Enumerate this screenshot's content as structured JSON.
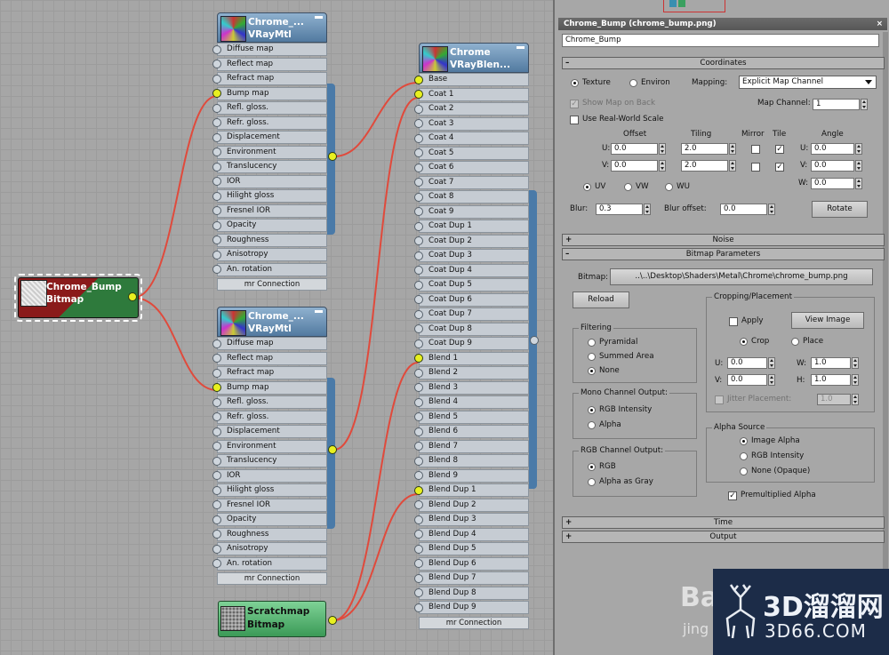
{
  "graph": {
    "source_chrome": {
      "title": "Chrome_Bump",
      "subtitle": "Bitmap"
    },
    "source_scratch": {
      "title": "Scratchmap",
      "subtitle": "Bitmap"
    },
    "vray_top": {
      "title": "Chrome_...",
      "subtitle": "VRayMtl",
      "footer": "mr Connection"
    },
    "vray_bottom": {
      "title": "Chrome_...",
      "subtitle": "VRayMtl",
      "footer": "mr Connection"
    },
    "vray_slots": [
      "Diffuse map",
      "Reflect map",
      "Refract map",
      "Bump map",
      "Refl. gloss.",
      "Refr. gloss.",
      "Displacement",
      "Environment",
      "Translucency",
      "IOR",
      "Hilight gloss",
      "Fresnel IOR",
      "Opacity",
      "Roughness",
      "Anisotropy",
      "An. rotation"
    ],
    "blend": {
      "title": "Chrome",
      "subtitle": "VRayBlen...",
      "footer": "mr Connection",
      "slots": [
        "Base",
        "Coat 1",
        "Coat 2",
        "Coat 3",
        "Coat 4",
        "Coat 5",
        "Coat 6",
        "Coat 7",
        "Coat 8",
        "Coat 9",
        "Coat Dup 1",
        "Coat Dup 2",
        "Coat Dup 3",
        "Coat Dup 4",
        "Coat Dup 5",
        "Coat Dup 6",
        "Coat Dup 7",
        "Coat Dup 8",
        "Coat Dup 9",
        "Blend 1",
        "Blend 2",
        "Blend 3",
        "Blend 4",
        "Blend 5",
        "Blend 6",
        "Blend 7",
        "Blend 8",
        "Blend 9",
        "Blend Dup 1",
        "Blend Dup 2",
        "Blend Dup 3",
        "Blend Dup 4",
        "Blend Dup 5",
        "Blend Dup 6",
        "Blend Dup 7",
        "Blend Dup 8",
        "Blend Dup 9"
      ]
    }
  },
  "panel": {
    "title": "Chrome_Bump (chrome_bump.png)",
    "close": "×",
    "name_value": "Chrome_Bump",
    "coordinates": {
      "header": "Coordinates",
      "sign": "–",
      "texture": "Texture",
      "environ": "Environ",
      "mapping_label": "Mapping:",
      "mapping_value": "Explicit Map Channel",
      "show_map_on_back": "Show Map on Back",
      "map_channel_label": "Map Channel:",
      "map_channel_value": "1",
      "use_real_world": "Use Real-World Scale",
      "offset": "Offset",
      "tiling": "Tiling",
      "mirror": "Mirror",
      "tile": "Tile",
      "angle": "Angle",
      "u": "U:",
      "v": "V:",
      "w": "W:",
      "offset_u": "0.0",
      "offset_v": "0.0",
      "tiling_u": "2.0",
      "tiling_v": "2.0",
      "angle_u": "0.0",
      "angle_v": "0.0",
      "angle_w": "0.0",
      "uv": "UV",
      "vw": "VW",
      "wu": "WU",
      "blur_label": "Blur:",
      "blur_value": "0.3",
      "blur_offset_label": "Blur offset:",
      "blur_offset_value": "0.0",
      "rotate": "Rotate",
      "tick": "✓"
    },
    "noise": {
      "header": "Noise",
      "sign": "+"
    },
    "bitmap_params": {
      "header": "Bitmap Parameters",
      "sign": "–",
      "bitmap_label": "Bitmap:",
      "bitmap_path": "..\\..\\Desktop\\Shaders\\Metal\\Chrome\\chrome_bump.png",
      "reload": "Reload",
      "filtering": "Filtering",
      "pyramidal": "Pyramidal",
      "summed_area": "Summed Area",
      "none": "None",
      "mono_output": "Mono Channel Output:",
      "rgb_intensity": "RGB Intensity",
      "alpha": "Alpha",
      "rgb_output": "RGB Channel Output:",
      "rgb": "RGB",
      "alpha_as_gray": "Alpha as Gray",
      "cropping": "Cropping/Placement",
      "apply": "Apply",
      "view_image": "View Image",
      "crop": "Crop",
      "place": "Place",
      "u_label": "U:",
      "v_label": "V:",
      "w_label": "W:",
      "h_label": "H:",
      "crop_u": "0.0",
      "crop_v": "0.0",
      "crop_w": "1.0",
      "crop_h": "1.0",
      "jitter": "Jitter Placement:",
      "jitter_value": "1.0",
      "alpha_source": "Alpha Source",
      "image_alpha": "Image Alpha",
      "rgb_intensity2": "RGB Intensity",
      "none_opaque": "None (Opaque)",
      "premultiplied": "Premultiplied Alpha"
    },
    "time": {
      "header": "Time",
      "sign": "+"
    },
    "output": {
      "header": "Output",
      "sign": "+"
    }
  },
  "watermark": {
    "brand": "3D溜溜网",
    "domain": "3D66.COM",
    "baidu": "Ba",
    "baidu_sub": "jing"
  },
  "colors": {
    "wire": "#e04a3c",
    "port_active": "#e8f020",
    "node_header": "#527aa0"
  }
}
